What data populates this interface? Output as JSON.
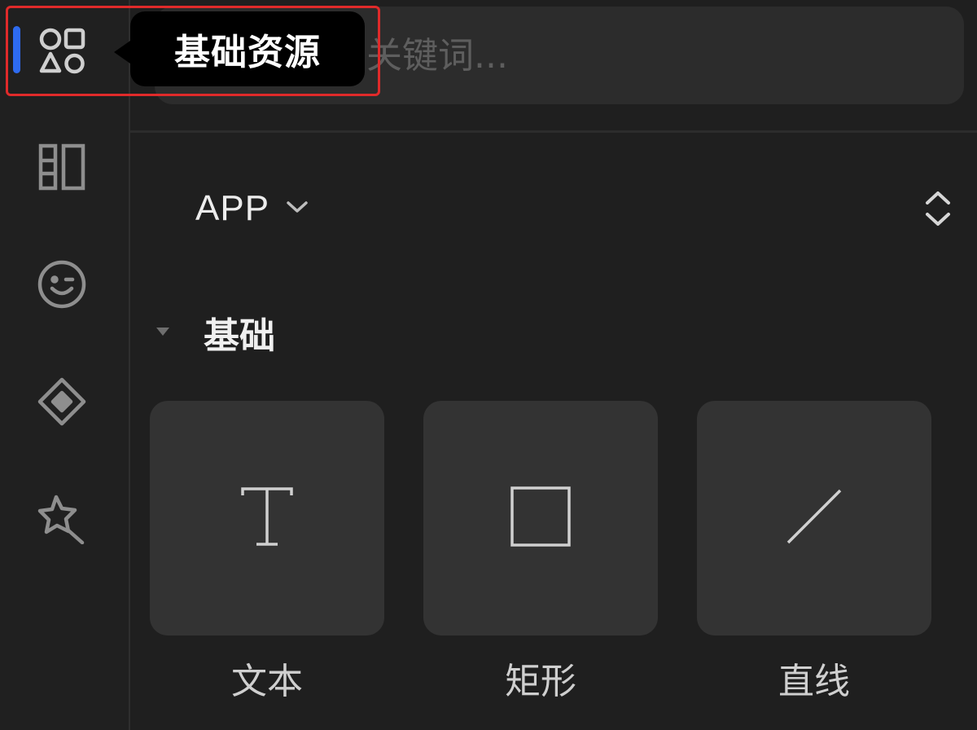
{
  "tooltip": {
    "text": "基础资源"
  },
  "search": {
    "placeholder": "关键词..."
  },
  "rail": {
    "items": [
      {
        "icon": "basic-resources-icon",
        "active": true
      },
      {
        "icon": "layout-columns-icon",
        "active": false
      },
      {
        "icon": "emoji-icon",
        "active": false
      },
      {
        "icon": "component-diamond-icon",
        "active": false
      },
      {
        "icon": "magic-star-icon",
        "active": false
      }
    ],
    "active_color": "#2e6bf0"
  },
  "selector": {
    "label": "APP"
  },
  "section": {
    "title": "基础"
  },
  "tiles": [
    {
      "label": "文本",
      "icon": "text-icon"
    },
    {
      "label": "矩形",
      "icon": "rectangle-icon"
    },
    {
      "label": "直线",
      "icon": "line-icon"
    }
  ],
  "colors": {
    "background": "#1f1f1f",
    "panel": "#333333",
    "tooltip": "#000000",
    "highlight": "#e02a2a"
  }
}
